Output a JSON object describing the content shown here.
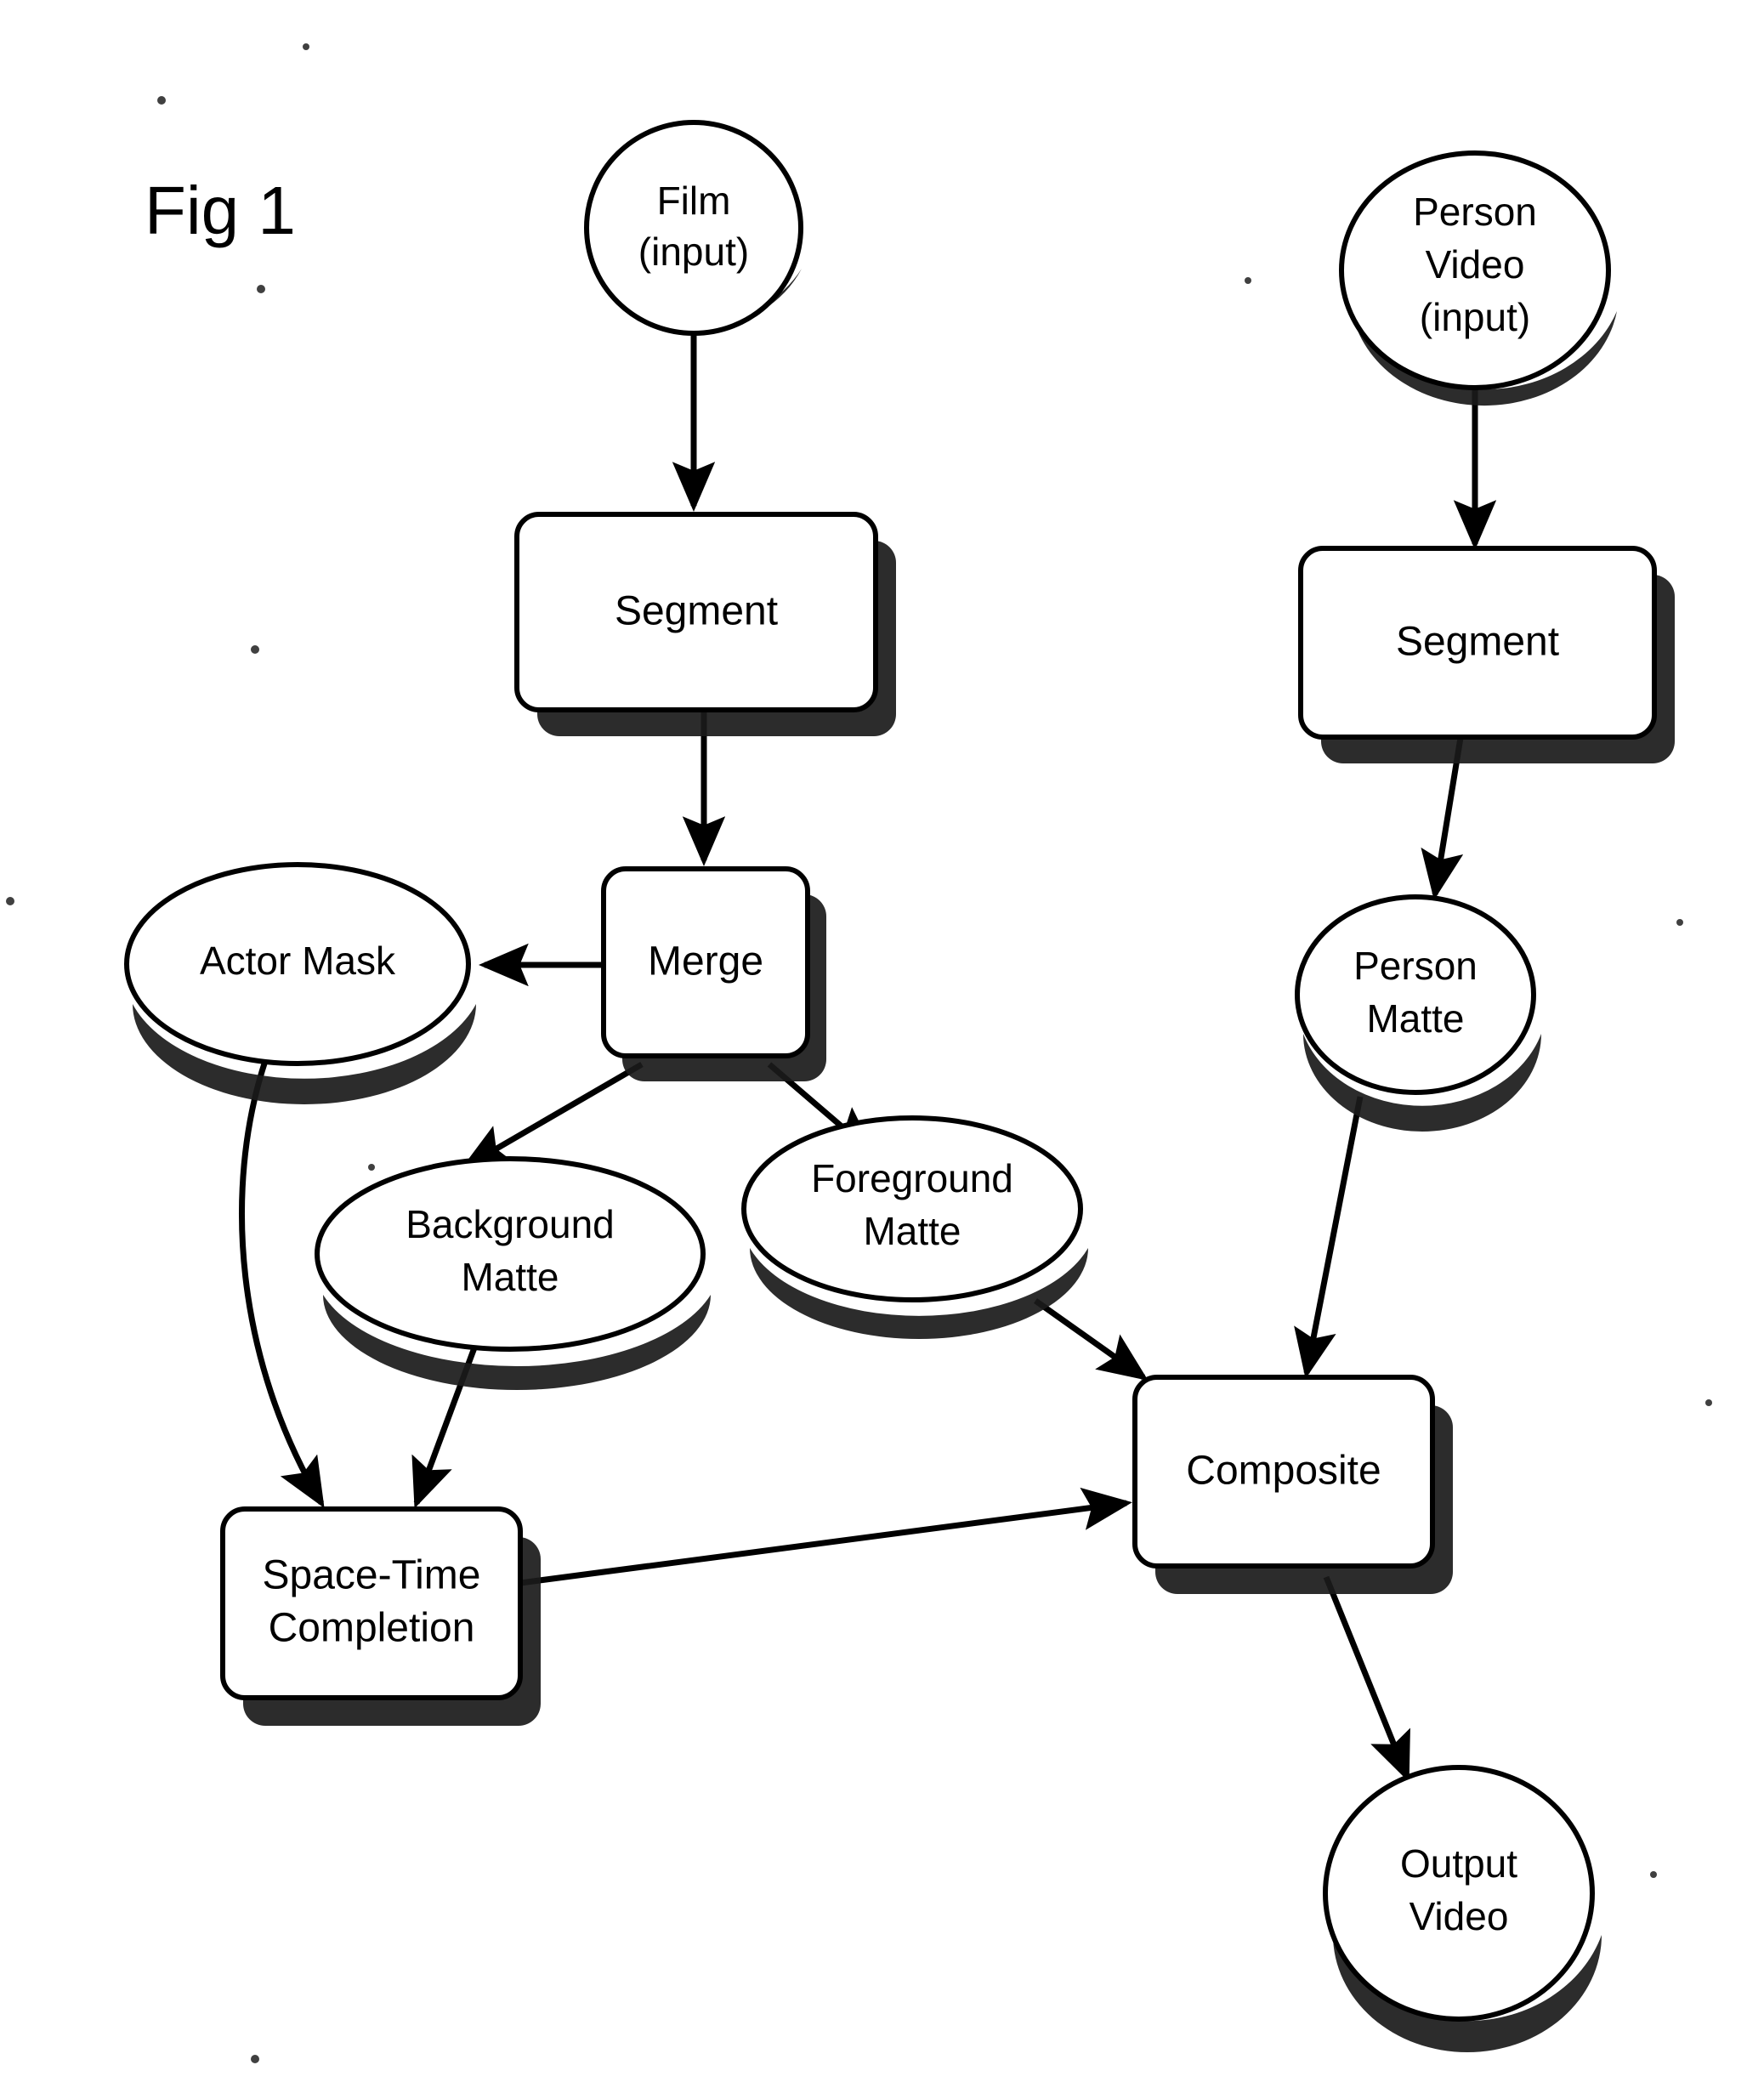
{
  "figure": {
    "title": "Fig 1",
    "background_color": "#ffffff",
    "ink_color": "#000000"
  },
  "nodes": [
    {
      "id": "film_input",
      "label": "Film\n(input)",
      "line1": "Film",
      "line2": "(input)",
      "line3": "",
      "shape": "ellipse"
    },
    {
      "id": "person_video",
      "label": "Person\nVideo\n(input)",
      "line1": "Person",
      "line2": "Video",
      "line3": "(input)",
      "shape": "ellipse"
    },
    {
      "id": "segment_left",
      "label": "Segment",
      "line1": "Segment",
      "line2": "",
      "line3": "",
      "shape": "box"
    },
    {
      "id": "segment_right",
      "label": "Segment",
      "line1": "Segment",
      "line2": "",
      "line3": "",
      "shape": "box"
    },
    {
      "id": "merge",
      "label": "Merge",
      "line1": "Merge",
      "line2": "",
      "line3": "",
      "shape": "box"
    },
    {
      "id": "actor_mask",
      "label": "Actor Mask",
      "line1": "Actor Mask",
      "line2": "",
      "line3": "",
      "shape": "ellipse"
    },
    {
      "id": "person_matte",
      "label": "Person\nMatte",
      "line1": "Person",
      "line2": "Matte",
      "line3": "",
      "shape": "ellipse"
    },
    {
      "id": "background_matte",
      "label": "Background\nMatte",
      "line1": "Background",
      "line2": "Matte",
      "line3": "",
      "shape": "ellipse"
    },
    {
      "id": "foreground_matte",
      "label": "Foreground\nMatte",
      "line1": "Foreground",
      "line2": "Matte",
      "line3": "",
      "shape": "ellipse"
    },
    {
      "id": "space_time",
      "label": "Space-Time\nCompletion",
      "line1": "Space-Time",
      "line2": "Completion",
      "line3": "",
      "shape": "box"
    },
    {
      "id": "composite",
      "label": "Composite",
      "line1": "Composite",
      "line2": "",
      "line3": "",
      "shape": "box"
    },
    {
      "id": "output_video",
      "label": "Output\nVideo",
      "line1": "Output",
      "line2": "Video",
      "line3": "",
      "shape": "ellipse"
    }
  ],
  "edges": [
    {
      "from": "film_input",
      "to": "segment_left",
      "arrow": true
    },
    {
      "from": "segment_left",
      "to": "merge",
      "arrow": true
    },
    {
      "from": "merge",
      "to": "actor_mask",
      "arrow": true
    },
    {
      "from": "merge",
      "to": "background_matte",
      "arrow": true
    },
    {
      "from": "merge",
      "to": "foreground_matte",
      "arrow": true
    },
    {
      "from": "person_video",
      "to": "segment_right",
      "arrow": true
    },
    {
      "from": "segment_right",
      "to": "person_matte",
      "arrow": true
    },
    {
      "from": "actor_mask",
      "to": "space_time",
      "arrow": true
    },
    {
      "from": "background_matte",
      "to": "space_time",
      "arrow": true
    },
    {
      "from": "space_time",
      "to": "composite",
      "arrow": true
    },
    {
      "from": "foreground_matte",
      "to": "composite",
      "arrow": true
    },
    {
      "from": "person_matte",
      "to": "composite",
      "arrow": true
    },
    {
      "from": "composite",
      "to": "output_video",
      "arrow": true
    }
  ]
}
